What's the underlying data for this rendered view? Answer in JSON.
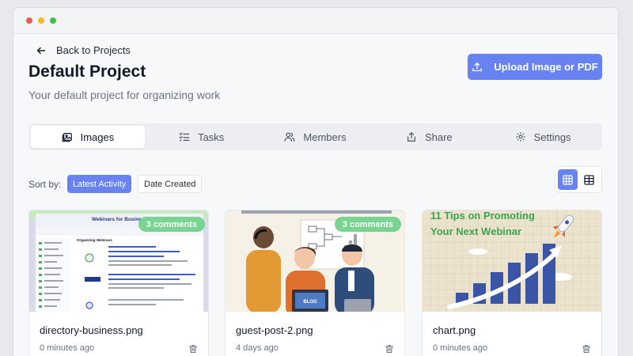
{
  "nav": {
    "back_label": "Back to Projects"
  },
  "project": {
    "title": "Default Project",
    "subtitle": "Your default project for organizing work"
  },
  "actions": {
    "upload_label": "Upload Image or PDF"
  },
  "tabs": [
    {
      "label": "Images",
      "icon": "image-icon",
      "active": true
    },
    {
      "label": "Tasks",
      "icon": "checklist-icon",
      "active": false
    },
    {
      "label": "Members",
      "icon": "users-icon",
      "active": false
    },
    {
      "label": "Share",
      "icon": "share-icon",
      "active": false
    },
    {
      "label": "Settings",
      "icon": "gear-icon",
      "active": false
    }
  ],
  "sort": {
    "label": "Sort by:",
    "options": [
      "Latest Activity",
      "Date Created"
    ],
    "selected": "Latest Activity"
  },
  "view": {
    "selected": "grid"
  },
  "cards": [
    {
      "filename": "directory-business.png",
      "time": "0 minutes ago",
      "comments": "3 comments",
      "thumb": {
        "header": "Webinars for Business",
        "nav_title": "Organizing Webinars"
      }
    },
    {
      "filename": "guest-post-2.png",
      "time": "4 days ago",
      "comments": "3 comments",
      "thumb": {
        "laptop_text": "BLOG"
      }
    },
    {
      "filename": "chart.png",
      "time": "0 minutes ago",
      "comments": "",
      "thumb": {
        "line1": "11 Tips on Promoting",
        "line2": "Your Next Webinar"
      }
    }
  ],
  "colors": {
    "accent": "#6883f1",
    "badge": "#79d391",
    "chart_title": "#3aa64a",
    "chart_bars": "#3a55a5"
  }
}
